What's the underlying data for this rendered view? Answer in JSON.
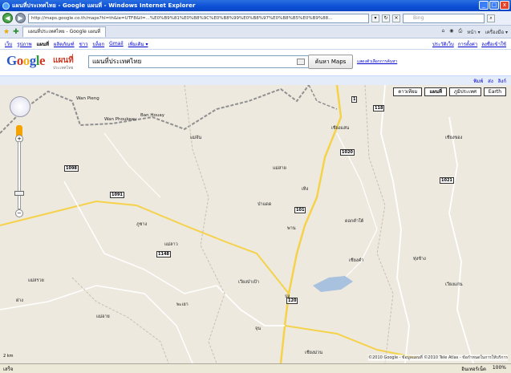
{
  "window": {
    "title": "แผนที่ประเทศไทย - Google แผนที่ - Windows Internet Explorer",
    "minimize": "_",
    "maximize": "□",
    "close": "x"
  },
  "browser": {
    "url": "http://maps.google.co.th/maps?hl=th&ie=UTF8&ll=...%E0%B9%81%E0%B8%9C%E0%B8%99%E0%B8%97%E0%B8%B5%E0%B9%88...",
    "search_placeholder": "Bing",
    "tab_label": "แผนที่ประเทศไทย - Google แผนที่",
    "tools": [
      "หน้า ▾",
      "เครื่องมือ ▾"
    ]
  },
  "google_nav": {
    "items": [
      "เว็บ",
      "รูปภาพ",
      "แผนที่",
      "ผลิตภัณฑ์",
      "ข่าว",
      "บล็อก",
      "Gmail",
      "เพิ่มเติม ▾"
    ],
    "active_index": 2,
    "right": [
      "ประวัติเว็บ",
      "การตั้งค่า",
      "ลงชื่อเข้าใช้"
    ]
  },
  "header": {
    "logo_text": "Google",
    "logo_sub": "แผนที่",
    "logo_sub2": "ประเทศไทย",
    "search_value": "แผนที่ประเทศไทย",
    "search_button": "ค้นหา Maps",
    "options_link": "แสดงตัวเลือกการค้นหา"
  },
  "map_strip": {
    "links": [
      "พิมพ์",
      "ส่ง",
      "ลิงก์"
    ]
  },
  "map": {
    "map_types": [
      "ดาวเทียม",
      "แผนที่",
      "ภูมิประเทศ",
      "Earth"
    ],
    "active_type": 1,
    "scale": "2 km",
    "copyright": "©2010 Google - ข้อมูลแผนที่ ©2010 Tele Atlas - ข้อกำหนดในการให้บริการ",
    "places": [
      {
        "name": "Wan Pieng",
        "cls": "p1"
      },
      {
        "name": "Wan Phoukeau",
        "cls": "p2"
      },
      {
        "name": "Ban Houay",
        "cls": "p3"
      },
      {
        "name": "เชียงแสน",
        "cls": "p4"
      },
      {
        "name": "แม่จัน",
        "cls": "p5"
      },
      {
        "name": "เชียงของ",
        "cls": "p6"
      },
      {
        "name": "แม่สาย",
        "cls": "p7"
      },
      {
        "name": "เทิง",
        "cls": "p8"
      },
      {
        "name": "ป่าแดด",
        "cls": "p9"
      },
      {
        "name": "พาน",
        "cls": "p10"
      },
      {
        "name": "ดอกคำใต้",
        "cls": "p11"
      },
      {
        "name": "ภูซาง",
        "cls": "p12"
      },
      {
        "name": "แม่ลาว",
        "cls": "p13"
      },
      {
        "name": "แม่สรวย",
        "cls": "p14"
      },
      {
        "name": "เวียงป่าเป้า",
        "cls": "p15"
      },
      {
        "name": "ปง",
        "cls": "p16"
      },
      {
        "name": "เชียงคำ",
        "cls": "p17"
      },
      {
        "name": "ทุ่งช้าง",
        "cls": "p18"
      },
      {
        "name": "เวียงแก่น",
        "cls": "p19"
      },
      {
        "name": "พะเยา",
        "cls": "p20"
      },
      {
        "name": "จุน",
        "cls": "p21"
      },
      {
        "name": "เชียงม่วน",
        "cls": "p22"
      },
      {
        "name": "ฝาง",
        "cls": "p23"
      },
      {
        "name": "แม่อาย",
        "cls": "p24"
      }
    ],
    "shields": [
      {
        "num": "1",
        "cls": "s1"
      },
      {
        "num": "118",
        "cls": "s2"
      },
      {
        "num": "1020",
        "cls": "s3"
      },
      {
        "num": "1098",
        "cls": "s4"
      },
      {
        "name": "",
        "num": "101",
        "cls": "s5"
      },
      {
        "num": "1091",
        "cls": "s6"
      },
      {
        "num": "1148",
        "cls": "s7"
      },
      {
        "num": "1021",
        "cls": "s8"
      },
      {
        "num": "120",
        "cls": "s9"
      }
    ]
  },
  "status": {
    "left": "เสร็จ",
    "zone": "อินเทอร์เน็ต",
    "zoom": "100%"
  }
}
